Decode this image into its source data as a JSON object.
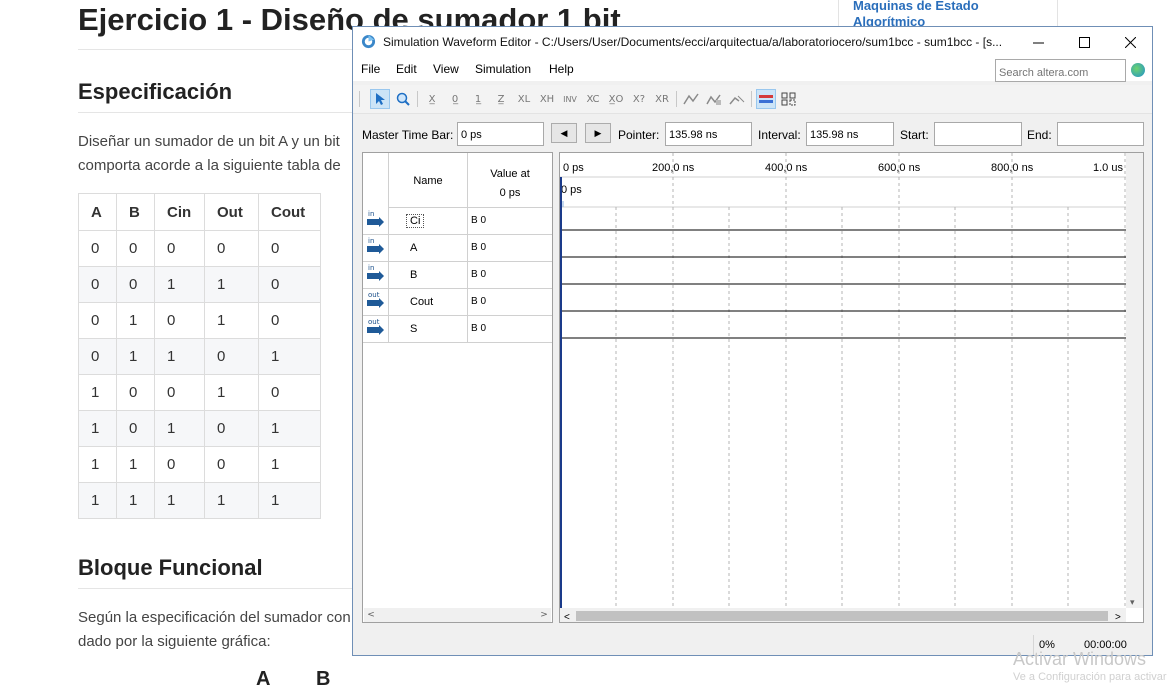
{
  "document": {
    "title": "Ejercicio 1 - Diseño de sumador 1 bit",
    "spec_heading": "Especificación",
    "spec_line1": "Diseñar un sumador de un bit A y un bit",
    "spec_line2": "comporta acorde a la siguiente tabla de",
    "truth_table": {
      "headers": [
        "A",
        "B",
        "Cin",
        "Out",
        "Cout"
      ],
      "rows": [
        [
          "0",
          "0",
          "0",
          "0",
          "0"
        ],
        [
          "0",
          "0",
          "1",
          "1",
          "0"
        ],
        [
          "0",
          "1",
          "0",
          "1",
          "0"
        ],
        [
          "0",
          "1",
          "1",
          "0",
          "1"
        ],
        [
          "1",
          "0",
          "0",
          "1",
          "0"
        ],
        [
          "1",
          "0",
          "1",
          "0",
          "1"
        ],
        [
          "1",
          "1",
          "0",
          "0",
          "1"
        ],
        [
          "1",
          "1",
          "1",
          "1",
          "1"
        ]
      ]
    },
    "block_heading": "Bloque Funcional",
    "block_line1": "Según la especificación del sumador con",
    "block_line2": "dado por la siguiente gráfica:",
    "diagram_labels": [
      "A",
      "B"
    ]
  },
  "sidebar": {
    "link_line1": "Maquinas de Estado",
    "link_line2": "Algorítmico"
  },
  "watermark": {
    "line1": "Activar Windows",
    "line2": "Ve a Configuración para activar Windows."
  },
  "window": {
    "title": "Simulation Waveform Editor - C:/Users/User/Documents/ecci/arquitectua/a/laboratoriocero/sum1bcc - sum1bcc - [s...",
    "menus": [
      "File",
      "Edit",
      "View",
      "Simulation",
      "Help"
    ],
    "search_placeholder": "Search altera.com",
    "toolbar_icons": [
      "pointer-tool-icon",
      "zoom-tool-icon",
      "force-unknown-icon",
      "force-low-icon",
      "force-high-icon",
      "force-high-impedance-icon",
      "force-weak-low-icon",
      "force-weak-high-icon",
      "invert-icon",
      "count-value-icon",
      "forcing-clock-icon",
      "arbitrary-value-icon",
      "random-value-icon",
      "snap-to-grid-icon",
      "sort-nodes-icon",
      "insert-node-icon",
      "group-icon",
      "ungroup-icon"
    ],
    "master_time_bar_label": "Master Time Bar:",
    "master_time_bar_value": "0 ps",
    "pointer_label": "Pointer:",
    "pointer_value": "135.98 ns",
    "interval_label": "Interval:",
    "interval_value": "135.98 ns",
    "start_label": "Start:",
    "start_value": "",
    "end_label": "End:",
    "end_value": "",
    "columns": {
      "name": "Name",
      "value_line1": "Value at",
      "value_line2": "0 ps"
    },
    "signals": [
      {
        "dir": "in",
        "name": "Ci",
        "value": "B 0"
      },
      {
        "dir": "in",
        "name": "A",
        "value": "B 0"
      },
      {
        "dir": "in",
        "name": "B",
        "value": "B 0"
      },
      {
        "dir": "out",
        "name": "Cout",
        "value": "B 0"
      },
      {
        "dir": "out",
        "name": "S",
        "value": "B 0"
      }
    ],
    "time_ruler": [
      "0 ps",
      "200,0 ns",
      "400,0 ns",
      "600,0 ns",
      "800,0 ns",
      "1.0 us"
    ],
    "cursor_label": "0 ps",
    "status_percent": "0%",
    "status_time": "00:00:00"
  }
}
